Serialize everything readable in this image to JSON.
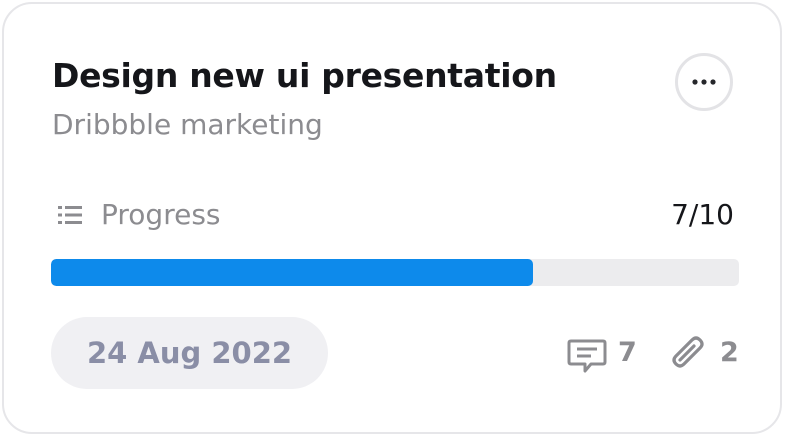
{
  "card": {
    "title": "Design new ui presentation",
    "subtitle": "Dribbble marketing",
    "more_icon": "ellipsis-icon"
  },
  "progress": {
    "label": "Progress",
    "count_text": "7/10",
    "fraction": 0.7,
    "icon": "list-icon",
    "fill_color": "#0d8aeb",
    "track_color": "#ececee"
  },
  "footer": {
    "date": "24 Aug 2022",
    "comments": {
      "icon": "comment-icon",
      "count": "7"
    },
    "attachments": {
      "icon": "paperclip-icon",
      "count": "2"
    }
  }
}
